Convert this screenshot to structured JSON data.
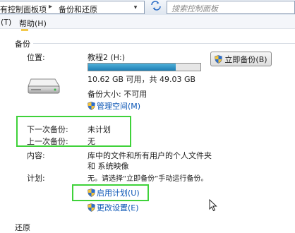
{
  "address_bar": {
    "crumbs": [
      "有控制面板项",
      "备份和还原"
    ],
    "separator": "▸",
    "dropdown": "▾",
    "search_placeholder": "搜索控制面板"
  },
  "menu": {
    "items": [
      "(T)",
      "帮助(H)"
    ]
  },
  "section": {
    "title": "备份",
    "bottom_title": "还原"
  },
  "backup": {
    "location_label": "位置:",
    "location_value": "教程2 (H:)",
    "usage_text": "10.62 GB 可用，共 49.03 GB",
    "usage_fraction": 0.78,
    "backup_size_label": "备份大小: 不可用",
    "manage_space_link": "管理空间(M)",
    "next_backup_label": "下一次备份:",
    "next_backup_value": "未计划",
    "last_backup_label": "上一次备份:",
    "last_backup_value": "无",
    "content_label": "内容:",
    "content_value_line1": "库中的文件和所有用户的个人文件夹",
    "content_value_line2": "和 系统映像",
    "schedule_label": "计划:",
    "schedule_value": "无。请选择“立即备份”手动运行备份。",
    "enable_schedule_link": "启用计划(U)",
    "change_settings_link": "更改设置(E)",
    "backup_now_button": "立即备份(B)"
  },
  "colors": {
    "link": "#0a55b5",
    "highlight_box": "#3fd23a",
    "usage_fill": "#1f7fb4"
  },
  "icons": {
    "drive": "hard-drive-icon",
    "shield": "uac-shield-icon",
    "refresh": "refresh-icon",
    "cursor": "mouse-pointer-icon"
  }
}
